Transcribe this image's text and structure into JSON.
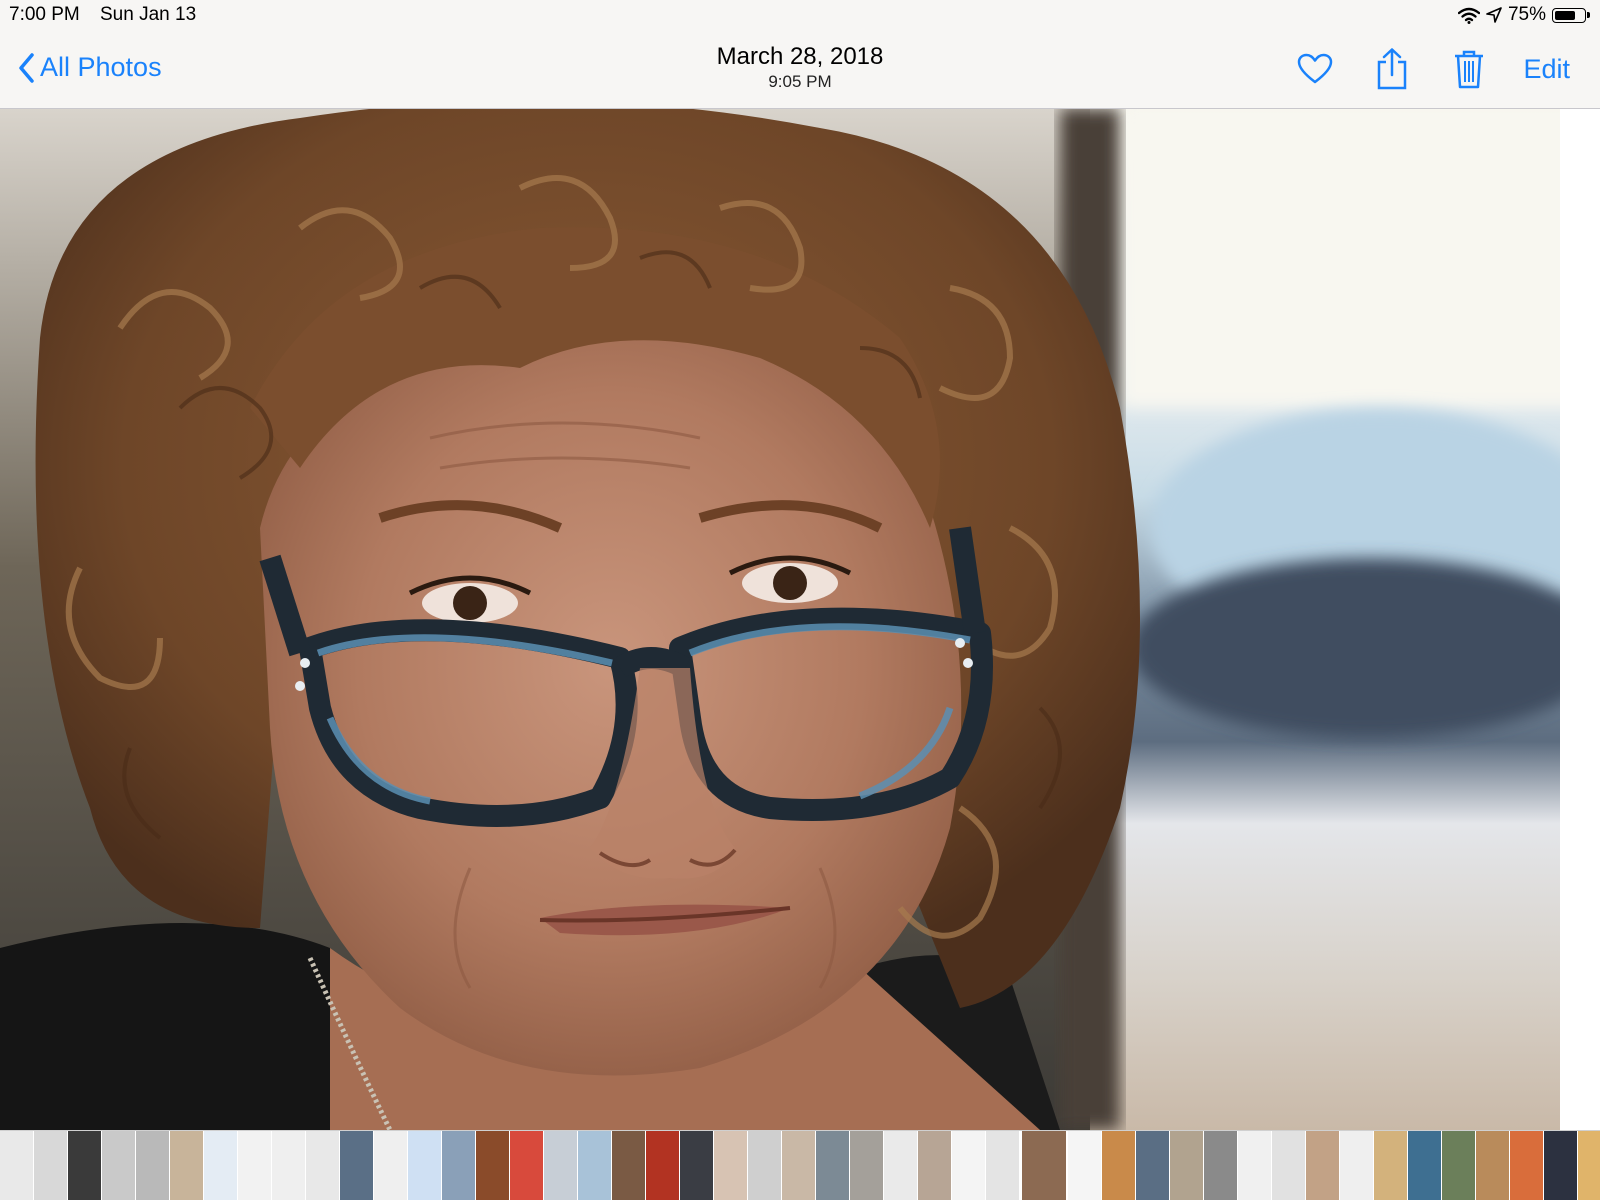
{
  "status_bar": {
    "time": "7:00 PM",
    "date": "Sun Jan 13",
    "battery": "75%",
    "battery_level": 0.75,
    "icons": [
      "wifi-icon",
      "location-arrow-icon",
      "battery-icon"
    ]
  },
  "nav": {
    "back_label": "All Photos",
    "title_date": "March 28, 2018",
    "title_time": "9:05 PM",
    "edit_label": "Edit",
    "icons": [
      "heart-icon",
      "share-icon",
      "trash-icon"
    ]
  },
  "colors": {
    "accent": "#1a82fb",
    "nav_background": "#f7f6f4"
  },
  "thumbnails": [
    {
      "tone": "#e9e9e9"
    },
    {
      "tone": "#d8d8d8"
    },
    {
      "tone": "#3a3a3a"
    },
    {
      "tone": "#c9c9c9"
    },
    {
      "tone": "#b9b9b9"
    },
    {
      "tone": "#c8b49a"
    },
    {
      "tone": "#e4ecf4"
    },
    {
      "tone": "#f2f2f2"
    },
    {
      "tone": "#efefef"
    },
    {
      "tone": "#e8e8e8"
    },
    {
      "tone": "#5a6f86"
    },
    {
      "tone": "#efefef"
    },
    {
      "tone": "#cfe0f3"
    },
    {
      "tone": "#8aa0b8"
    },
    {
      "tone": "#8a4b2a"
    },
    {
      "tone": "#d84a3c"
    },
    {
      "tone": "#c7ced6"
    },
    {
      "tone": "#a8c2d8"
    },
    {
      "tone": "#7a5a44"
    },
    {
      "tone": "#b23322"
    },
    {
      "tone": "#3a3d44"
    },
    {
      "tone": "#d7c3b3"
    },
    {
      "tone": "#cfcfcf"
    },
    {
      "tone": "#c9b8a6"
    },
    {
      "tone": "#7c8a95"
    },
    {
      "tone": "#a4a09a"
    },
    {
      "tone": "#eaeaea"
    },
    {
      "tone": "#b7a595"
    },
    {
      "tone": "#f4f4f4"
    },
    {
      "tone": "#e4e4e4"
    },
    {
      "tone": "#8c6a52",
      "current": true
    },
    {
      "tone": "#f5f5f5"
    },
    {
      "tone": "#c98a4a"
    },
    {
      "tone": "#5a6e84"
    },
    {
      "tone": "#b1a38f"
    },
    {
      "tone": "#8a8a8a"
    },
    {
      "tone": "#f0f0f0"
    },
    {
      "tone": "#e1e1e1"
    },
    {
      "tone": "#c2a286"
    },
    {
      "tone": "#efefef"
    },
    {
      "tone": "#d3b27c"
    },
    {
      "tone": "#3e6f91"
    },
    {
      "tone": "#6b7f5a"
    },
    {
      "tone": "#b98b5b"
    },
    {
      "tone": "#d96d3b"
    },
    {
      "tone": "#2c3140"
    },
    {
      "tone": "#e0b46a"
    },
    {
      "tone": "#dedede"
    },
    {
      "tone": "#f4f1e8"
    },
    {
      "tone": "#b08a62"
    },
    {
      "tone": "#c0c0c0"
    },
    {
      "tone": "#f2f2f2"
    },
    {
      "tone": "#d4d4d4"
    },
    {
      "tone": "#f5f5f5"
    },
    {
      "tone": "#b57b3a"
    },
    {
      "tone": "#7aa1c3"
    },
    {
      "tone": "#e8e8e8"
    }
  ]
}
